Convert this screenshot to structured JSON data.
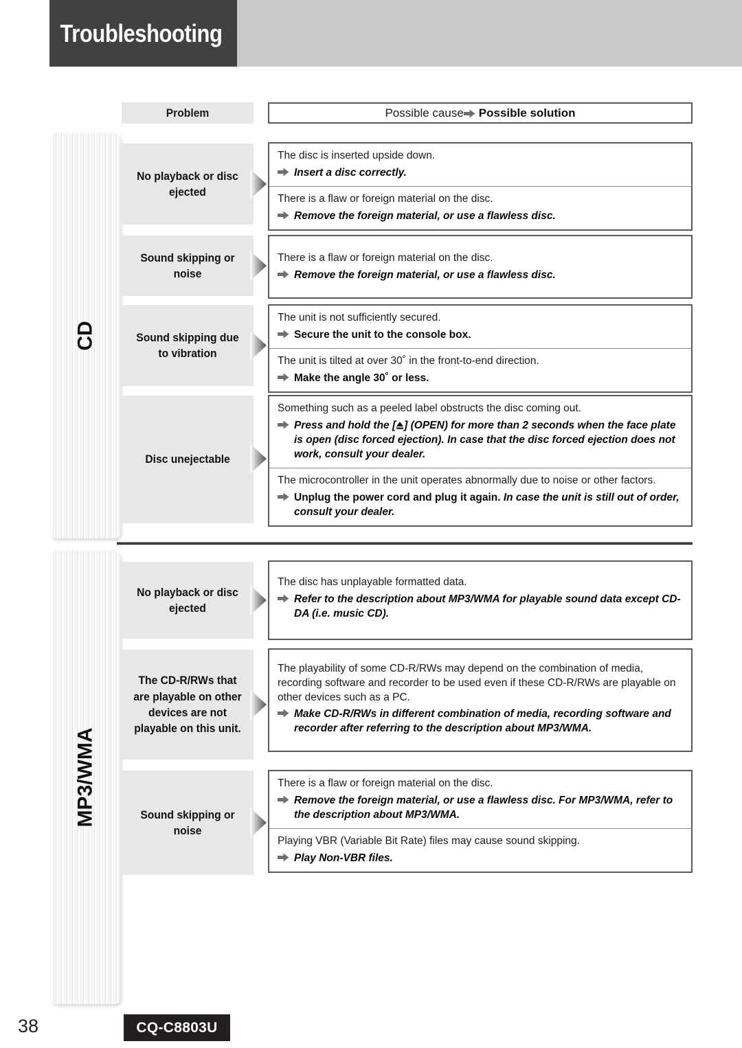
{
  "header": {
    "title": "Troubleshooting"
  },
  "table_header": {
    "problem": "Problem",
    "cause_prefix": "Possible cause ",
    "solution_label": "Possible solution"
  },
  "sections": [
    {
      "tab_label": "CD",
      "rows": [
        {
          "problem": "No playback or disc ejected",
          "parts": [
            {
              "cause": "The disc is inserted upside down.",
              "solution": "Insert a disc correctly."
            },
            {
              "cause": "There is a flaw or foreign material on the disc.",
              "solution": "Remove the foreign material, or use a flawless disc."
            }
          ]
        },
        {
          "problem": "Sound skipping or noise",
          "parts": [
            {
              "cause": "There is a flaw or foreign material on the disc.",
              "solution": "Remove the foreign material, or use a flawless disc."
            }
          ]
        },
        {
          "problem": "Sound skipping due to vibration",
          "parts": [
            {
              "cause": "The unit is not sufficiently secured.",
              "solution": "Secure the unit to the console box."
            },
            {
              "cause": "The unit is tilted at over 30˚ in the front-to-end direction.",
              "solution": "Make the angle 30˚ or less."
            }
          ]
        },
        {
          "problem": "Disc unejectable",
          "parts": [
            {
              "cause": "Something such as a peeled label obstructs the disc coming out.",
              "solution_pre": "Press and hold the [",
              "solution_post": "] (OPEN) for more than 2 seconds when the face plate is open (disc forced ejection). In case that the disc forced ejection does not work, consult your dealer.",
              "solution_icon": "eject-icon"
            },
            {
              "cause": "The microcontroller in the unit operates abnormally due to noise or other factors.",
              "solution_upright": "Unplug the power cord and plug it again. ",
              "solution_italic": "In case the unit is still out of order, consult your dealer."
            }
          ]
        }
      ]
    },
    {
      "tab_label": "MP3/WMA",
      "rows": [
        {
          "problem": "No playback or disc ejected",
          "parts": [
            {
              "cause": "The disc has unplayable formatted data.",
              "solution": "Refer to the description about MP3/WMA for playable sound data except CD-DA (i.e. music CD)."
            }
          ]
        },
        {
          "problem": "The CD-R/RWs that are playable on other devices are not playable on this unit.",
          "parts": [
            {
              "cause": "The playability of some CD-R/RWs may depend on the combination of media, recording software and recorder to be used even if these CD-R/RWs are playable on other devices such as a PC.",
              "solution": "Make CD-R/RWs in different combination of media, recording software and recorder after referring to the description about MP3/WMA."
            }
          ]
        },
        {
          "problem": "Sound skipping or noise",
          "parts": [
            {
              "cause": "There is a flaw or foreign material on the disc.",
              "solution": "Remove the foreign material, or use a flawless disc. For MP3/WMA, refer to the description about MP3/WMA."
            },
            {
              "cause": "Playing VBR (Variable Bit Rate) files may cause sound skipping.",
              "solution": "Play Non-VBR files."
            }
          ]
        }
      ]
    }
  ],
  "footer": {
    "page_number": "38",
    "model": "CQ-C8803U"
  },
  "colors": {
    "header_dark": "#414141",
    "header_band": "#c9c9c9",
    "problem_cell": "#e7e7e7",
    "box_border": "#595959",
    "badge_bg": "#231f20"
  }
}
